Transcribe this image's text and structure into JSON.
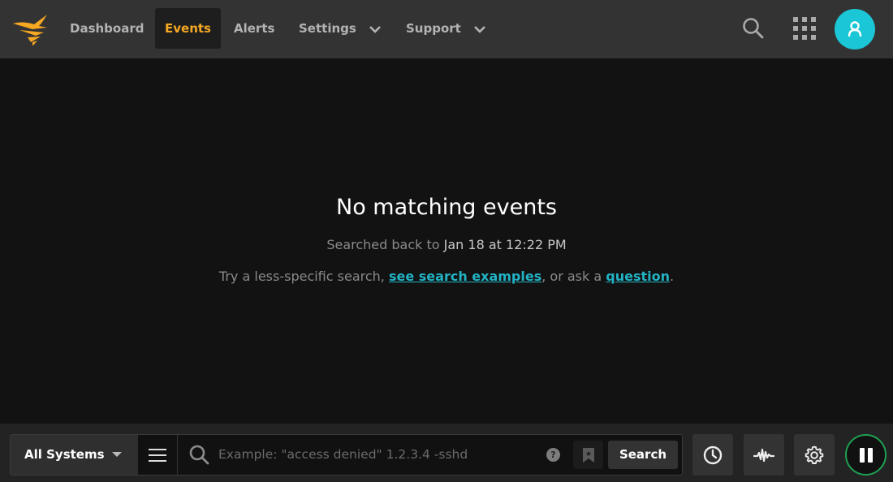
{
  "nav": {
    "items": [
      {
        "label": "Dashboard",
        "active": false,
        "dropdown": false
      },
      {
        "label": "Events",
        "active": true,
        "dropdown": false
      },
      {
        "label": "Alerts",
        "active": false,
        "dropdown": false
      },
      {
        "label": "Settings",
        "active": false,
        "dropdown": true
      },
      {
        "label": "Support",
        "active": false,
        "dropdown": true
      }
    ],
    "icons": [
      "logo-icon",
      "search-icon",
      "apps-grid-icon",
      "user-avatar-icon"
    ],
    "accent_color": "#f7a823",
    "avatar_color": "#1bc6d6"
  },
  "empty_state": {
    "title": "No matching events",
    "searched_prefix": "Searched back to",
    "searched_date": "Jan 18 at 12:22 PM",
    "hint_prefix": "Try a less-specific search,",
    "hint_link1": "see search examples",
    "hint_middle": ", or ask a",
    "hint_link2": "question",
    "hint_suffix": ".",
    "link_color": "#22b3c4"
  },
  "search_bar": {
    "systems_label": "All Systems",
    "value": "",
    "placeholder": "Example: \"access denied\" 1.2.3.4 -sshd",
    "help_label": "?",
    "search_label": "Search"
  },
  "tools": [
    "history-clock-icon",
    "activity-waveform-icon",
    "gear-icon",
    "pause-icon"
  ],
  "live_color": "#1fa050"
}
